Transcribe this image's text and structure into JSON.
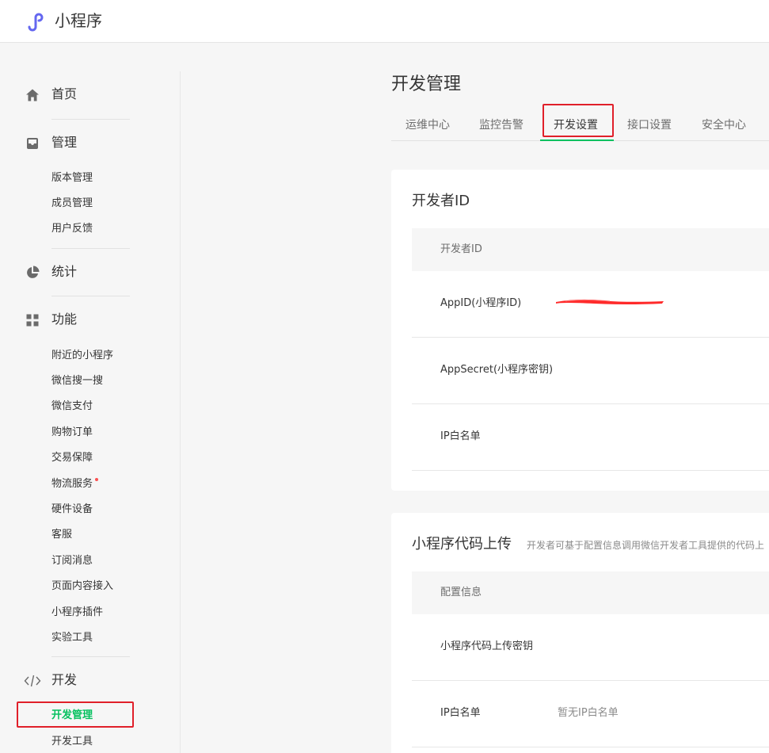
{
  "header": {
    "brand": "小程序",
    "logo_icon": "mini-program-logo-icon",
    "accent": "#07c160"
  },
  "sidebar": {
    "home": {
      "label": "首页",
      "icon": "home-icon"
    },
    "manage": {
      "label": "管理",
      "icon": "inbox-icon",
      "items": [
        "版本管理",
        "成员管理",
        "用户反馈"
      ]
    },
    "stats": {
      "label": "统计",
      "icon": "pie-chart-icon"
    },
    "features": {
      "label": "功能",
      "icon": "grid-icon",
      "items": [
        "附近的小程序",
        "微信搜一搜",
        "微信支付",
        "购物订单",
        "交易保障",
        "物流服务",
        "硬件设备",
        "客服",
        "订阅消息",
        "页面内容接入",
        "小程序插件",
        "实验工具"
      ]
    },
    "dev": {
      "label": "开发",
      "icon": "code-icon",
      "items": [
        "开发管理",
        "开发工具"
      ]
    }
  },
  "main": {
    "title": "开发管理",
    "tabs": [
      "运维中心",
      "监控告警",
      "开发设置",
      "接口设置",
      "安全中心"
    ],
    "active_tab": "开发设置",
    "developer_id": {
      "title": "开发者ID",
      "header": "开发者ID",
      "rows": [
        "AppID(小程序ID)",
        "AppSecret(小程序密钥)",
        "IP白名单"
      ]
    },
    "code_upload": {
      "title": "小程序代码上传",
      "desc": "开发者可基于配置信息调用微信开发者工具提供的代码上",
      "header": "配置信息",
      "rows": [
        {
          "label": "小程序代码上传密钥",
          "value": ""
        },
        {
          "label": "IP白名单",
          "value": "暂无IP白名单"
        }
      ]
    }
  }
}
